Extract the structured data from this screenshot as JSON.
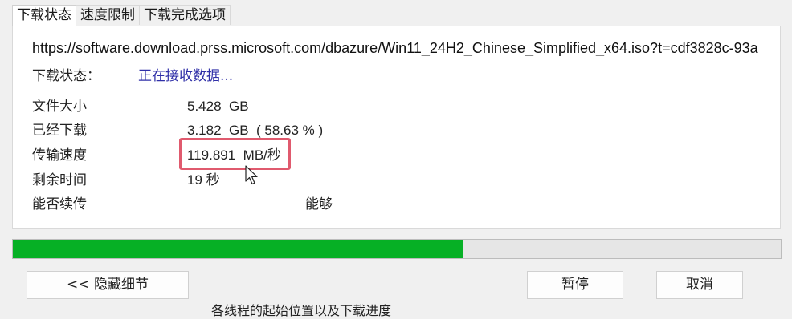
{
  "tabs": [
    "下载状态",
    "速度限制",
    "下载完成选项"
  ],
  "url": "https://software.download.prss.microsoft.com/dbazure/Win11_24H2_Chinese_Simplified_x64.iso?t=cdf3828c-93a",
  "status": {
    "label": "下载状态：",
    "value": "正在接收数据..."
  },
  "file_size": {
    "label": "文件大小",
    "value": "5.428",
    "unit": "GB"
  },
  "downloaded": {
    "label": "已经下载",
    "value": "3.182",
    "unit": "GB",
    "percent": "( 58.63 % )"
  },
  "speed": {
    "label": "传输速度",
    "value": "119.891",
    "unit": "MB/秒"
  },
  "remaining": {
    "label": "剩余时间",
    "value": "19",
    "unit": "秒"
  },
  "resume": {
    "label": "能否续传",
    "value": "能够"
  },
  "progress": {
    "fraction": 0.5863,
    "color": "#06b025"
  },
  "buttons": {
    "hide_details": "<< 隐藏细节",
    "pause": "暂停",
    "cancel": "取消"
  },
  "footer_text": "各线程的起始位置以及下载进度"
}
